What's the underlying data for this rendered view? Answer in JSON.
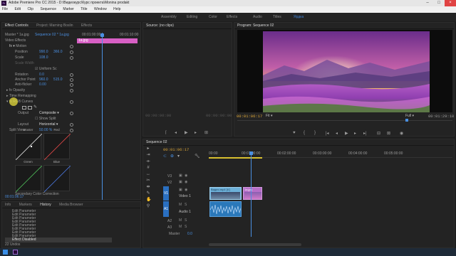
{
  "window": {
    "title": "Adobe Premiere Pro CC 2015 - D:\\Видеокурс\\Курс проекта\\Monina prodakt"
  },
  "menu": [
    "File",
    "Edit",
    "Clip",
    "Sequence",
    "Marker",
    "Title",
    "Window",
    "Help"
  ],
  "workspaces": [
    "Assembly",
    "Editing",
    "Color",
    "Effects",
    "Audio",
    "Titles",
    "Ярдка"
  ],
  "active_workspace_index": 6,
  "effect_controls": {
    "tabs": [
      "Effect Controls",
      "Project: Marning Boslin",
      "Effects"
    ],
    "master_label": "Master * 1a.jpg",
    "sequence_label": "Sequence 02 * 1a.jpg",
    "ruler_start": "00:01:00:00",
    "ruler_end": "00:01:10:00",
    "clip_name": "1a.jpg",
    "section": "Video Effects",
    "motion": "Motion",
    "params": [
      {
        "name": "Position",
        "v1": "990.0",
        "v2": "366.0"
      },
      {
        "name": "Scale",
        "v1": "108.0",
        "v2": ""
      },
      {
        "name": "Scale Width",
        "v1": "",
        "v2": ""
      },
      {
        "name": "Uniform Sc",
        "v1": "",
        "v2": ""
      },
      {
        "name": "Rotation",
        "v1": "0.0",
        "v2": ""
      },
      {
        "name": "Anchor Point",
        "v1": "960.0",
        "v2": "515.0"
      },
      {
        "name": "Anti-flicker",
        "v1": "0.00",
        "v2": ""
      }
    ],
    "opacity": "Opacity",
    "time_remap": "Time Remapping",
    "curves": "RGB Curves",
    "output_label": "Output",
    "output_value": "Composite",
    "show_split": "Show Split",
    "layout_label": "Layout",
    "layout_value": "Horizontal",
    "split_label": "Split View",
    "split_value": "50.00 %",
    "curve_titles": [
      "Master",
      "Red",
      "Green",
      "Blue"
    ],
    "secondary": "Secondary Color Correction",
    "timecode": "00:01:06:17"
  },
  "history": {
    "tabs": [
      "Info",
      "Markers",
      "History",
      "Media Browser"
    ],
    "items": [
      "Edit Parameter",
      "Edit Parameter",
      "Edit Parameter",
      "Edit Parameter",
      "Edit Parameter",
      "Edit Parameter",
      "Edit Parameter",
      "Edit Parameter",
      "Effect Disabled"
    ],
    "footer": "22 Undos"
  },
  "source_monitor": {
    "tab": "Source: (no clips)",
    "timecode_left": "00:00:00:00",
    "timecode_right": "00:00:00:00"
  },
  "program_monitor": {
    "tab": "Program: Sequence 02",
    "timecode": "00:01:06:17",
    "fit": "Fit",
    "quality": "Full",
    "duration": "00:01:29:10"
  },
  "timeline": {
    "tab": "Sequence 02",
    "timecode": "00:01:06:17",
    "ruler": [
      "00:00",
      "00:01:00:00",
      "00:02:00:00",
      "00:03:00:00",
      "00:04:00:00",
      "00:05:00:00"
    ],
    "tracks": [
      {
        "id": "V3",
        "name": ""
      },
      {
        "id": "V2",
        "name": ""
      },
      {
        "id": "V1",
        "name": "Video 1"
      },
      {
        "id": "A1",
        "name": "Audio 1"
      },
      {
        "id": "A2",
        "name": ""
      },
      {
        "id": "A3",
        "name": ""
      }
    ],
    "master_label": "Master",
    "master_value": "0.0",
    "clip_video_label": "Видео.mp4 [V]",
    "clip_video2_label": "1a.jpg",
    "colors": {
      "video_clip": "#6db0d8",
      "audio_clip": "#2a78ba",
      "playhead": "#4a90e2",
      "timecode": "#d8a337"
    }
  }
}
